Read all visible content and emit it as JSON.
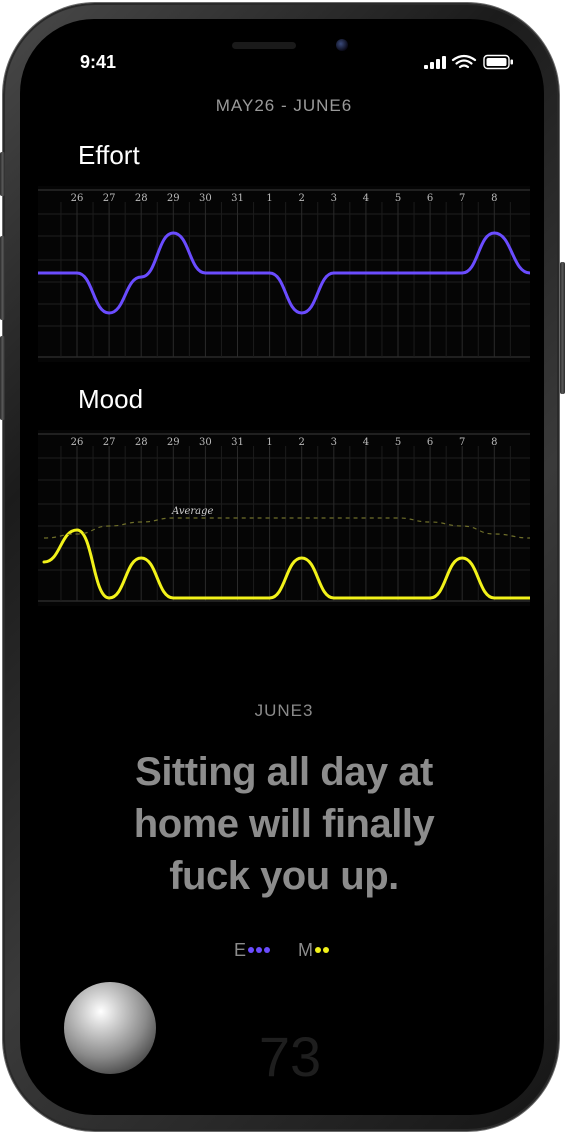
{
  "status": {
    "time": "9:41"
  },
  "range_title": "MAY26 - JUNE6",
  "sections": {
    "effort": {
      "label": "Effort"
    },
    "mood": {
      "label": "Mood",
      "average_label": "Average"
    }
  },
  "day_labels": [
    "26",
    "27",
    "28",
    "29",
    "30",
    "31",
    "1",
    "2",
    "3",
    "4",
    "5",
    "6",
    "7",
    "8"
  ],
  "selected_date": "JUNE3",
  "quote": "Sitting all day at home will finally fuck you up.",
  "legend": {
    "effort_letter": "E",
    "mood_letter": "M"
  },
  "colors": {
    "effort": "#6a4cff",
    "mood": "#f2f21a",
    "average": "#6f6f2a"
  },
  "score": "73",
  "chart_data": [
    {
      "type": "line",
      "title": "Effort",
      "categories": [
        "26",
        "27",
        "28",
        "29",
        "30",
        "31",
        "1",
        "2",
        "3",
        "4",
        "5",
        "6",
        "7",
        "8"
      ],
      "series": [
        {
          "values": [
            0,
            -1,
            -0.1,
            1,
            0,
            0,
            0,
            -1,
            0,
            0,
            0,
            0,
            0,
            1
          ]
        }
      ]
    },
    {
      "type": "line",
      "title": "Mood",
      "categories": [
        "26",
        "27",
        "28",
        "29",
        "30",
        "31",
        "1",
        "2",
        "3",
        "4",
        "5",
        "6",
        "7",
        "8"
      ],
      "series": [
        {
          "values": [
            1.7,
            0,
            1,
            0,
            0,
            0,
            0,
            1,
            0,
            0,
            0,
            0,
            1,
            0
          ]
        },
        {
          "name": "Average",
          "values": [
            1.6,
            1.8,
            1.9,
            2,
            2,
            2,
            2,
            2,
            2,
            2,
            2,
            1.9,
            1.8,
            1.6
          ]
        }
      ]
    }
  ]
}
